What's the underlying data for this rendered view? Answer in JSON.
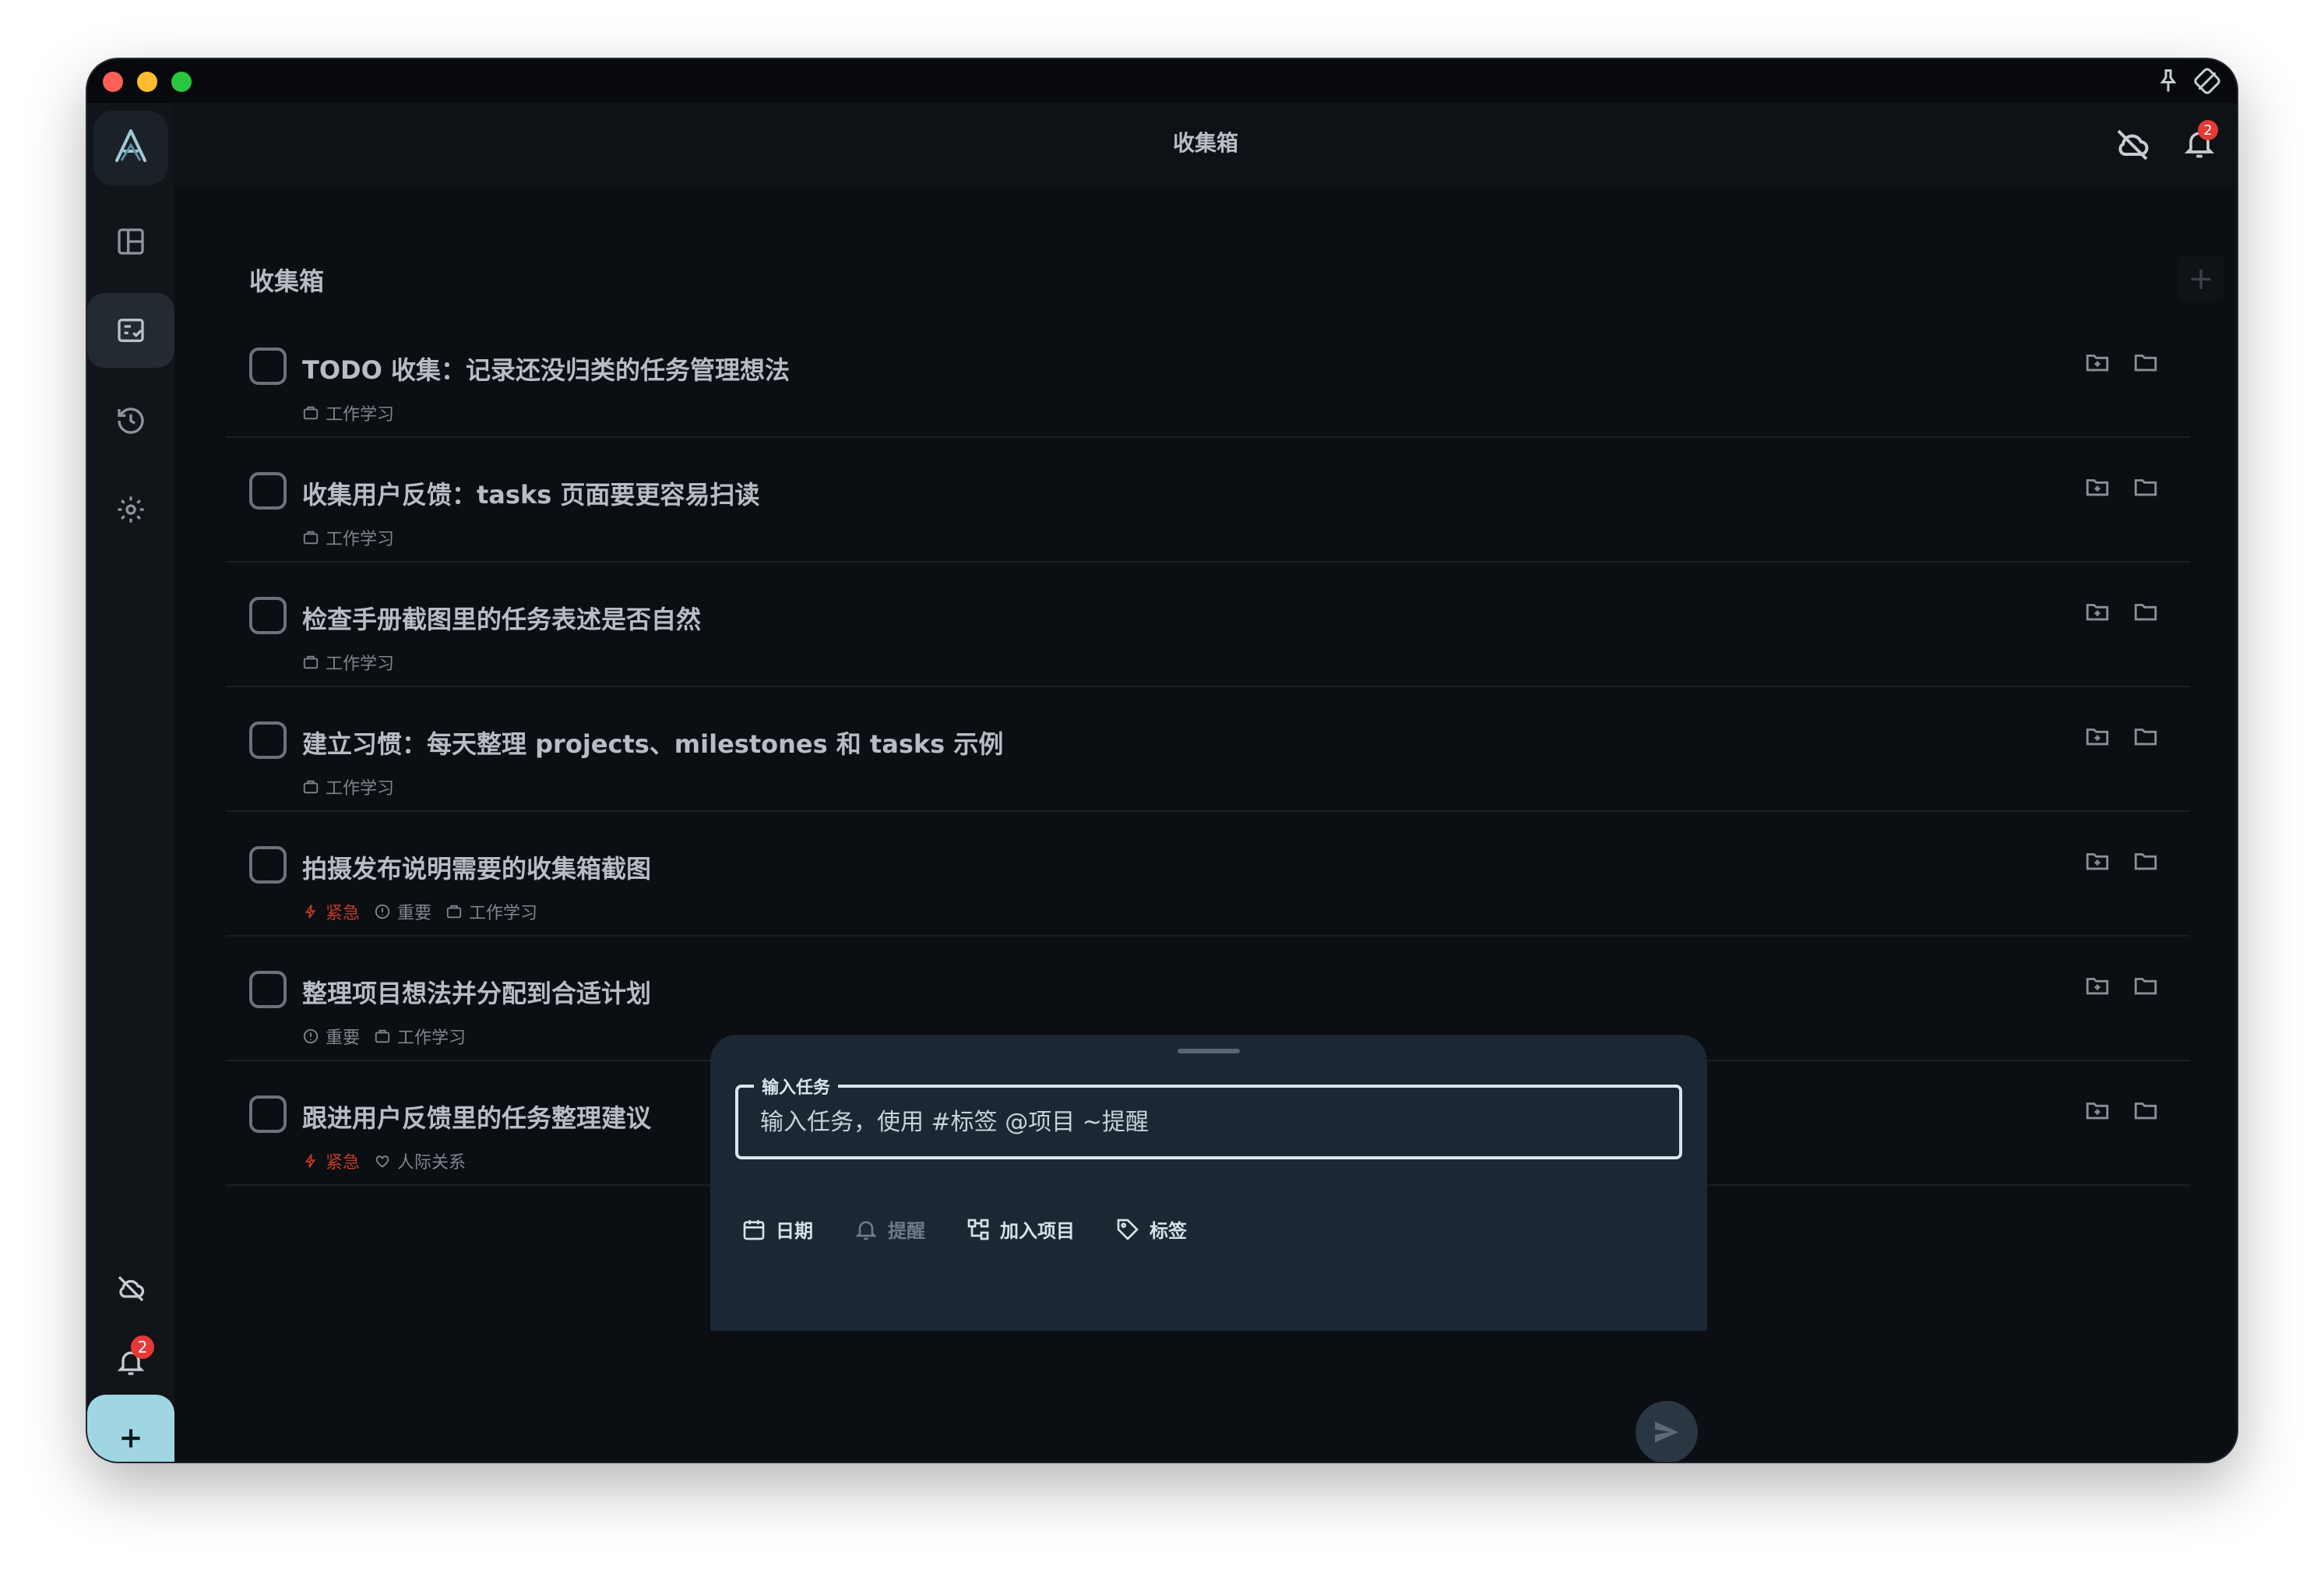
{
  "window": {
    "header_title": "收集箱",
    "sidebar_badge_count": "2",
    "header_badge_count": "2"
  },
  "inbox": {
    "section_title": "收集箱",
    "add_label": "+",
    "tasks": [
      {
        "title": "TODO 收集：记录还没归类的任务管理想法",
        "meta": [
          {
            "type": "project",
            "label": "工作学习"
          }
        ]
      },
      {
        "title": "收集用户反馈：tasks 页面要更容易扫读",
        "meta": [
          {
            "type": "project",
            "label": "工作学习"
          }
        ]
      },
      {
        "title": "检查手册截图里的任务表述是否自然",
        "meta": [
          {
            "type": "project",
            "label": "工作学习"
          }
        ]
      },
      {
        "title": "建立习惯：每天整理 projects、milestones 和 tasks 示例",
        "meta": [
          {
            "type": "project",
            "label": "工作学习"
          }
        ]
      },
      {
        "title": "拍摄发布说明需要的收集箱截图",
        "meta": [
          {
            "type": "urgent",
            "label": "紧急"
          },
          {
            "type": "important",
            "label": "重要"
          },
          {
            "type": "project",
            "label": "工作学习"
          }
        ]
      },
      {
        "title": "整理项目想法并分配到合适计划",
        "meta": [
          {
            "type": "important",
            "label": "重要"
          },
          {
            "type": "project",
            "label": "工作学习"
          }
        ]
      },
      {
        "title": "跟进用户反馈里的任务整理建议",
        "meta": [
          {
            "type": "urgent",
            "label": "紧急"
          },
          {
            "type": "relation",
            "label": "人际关系"
          }
        ]
      }
    ]
  },
  "composer": {
    "field_label": "输入任务",
    "placeholder": "输入任务，使用 #标签 @项目 ~提醒",
    "value": "",
    "chip_date": "日期",
    "chip_reminder": "提醒",
    "chip_project": "加入项目",
    "chip_tag": "标签"
  },
  "colors": {
    "accent": "#9fd6e2",
    "urgent": "#c0392b",
    "badge": "#e53935"
  }
}
